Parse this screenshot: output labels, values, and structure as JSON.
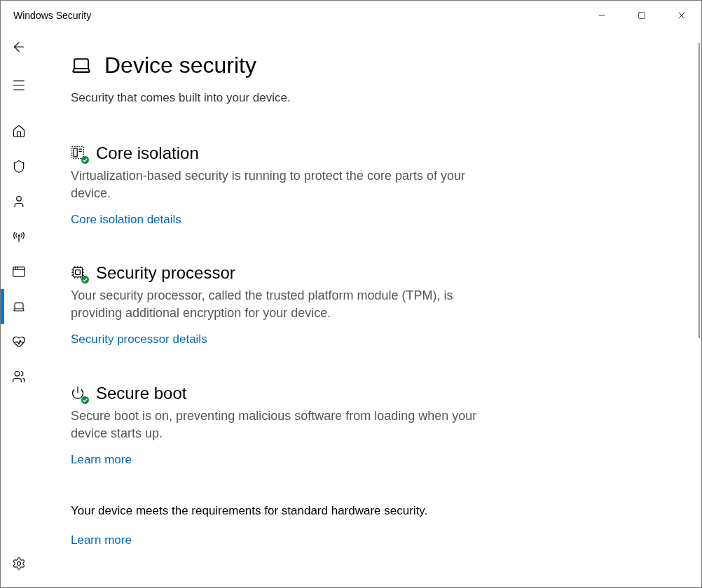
{
  "window": {
    "title": "Windows Security"
  },
  "nav": [
    {
      "selected": false
    },
    {
      "selected": false
    },
    {
      "selected": false
    },
    {
      "selected": false
    },
    {
      "selected": false
    },
    {
      "selected": true
    },
    {
      "selected": false
    },
    {
      "selected": false
    }
  ],
  "page": {
    "title": "Device security",
    "subtitle": "Security that comes built into your device."
  },
  "sections": [
    {
      "title": "Core isolation",
      "description": "Virtualization-based security is running to protect the core parts of your device.",
      "link": "Core isolation details",
      "ok": true
    },
    {
      "title": "Security processor",
      "description": "Your security processor, called the trusted platform module (TPM), is providing additional encryption for your device.",
      "link": "Security processor details",
      "ok": true
    },
    {
      "title": "Secure boot",
      "description": "Secure boot is on, preventing malicious software from loading when your device starts up.",
      "link": "Learn more",
      "ok": true
    }
  ],
  "footer": {
    "text": "Your device meets the requirements for standard hardware security.",
    "link": "Learn more"
  }
}
